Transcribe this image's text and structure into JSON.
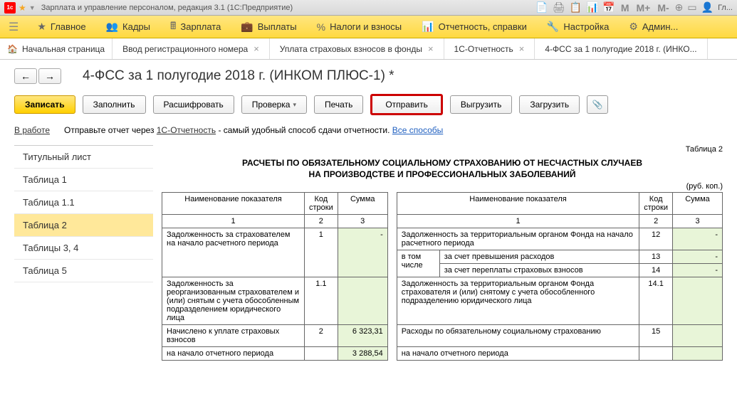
{
  "titlebar": {
    "app_icon": "1с",
    "text": "Зарплата и управление персоналом, редакция 3.1  (1С:Предприятие)",
    "user_label": "Гл..."
  },
  "mainmenu": {
    "items": [
      {
        "label": "Главное"
      },
      {
        "label": "Кадры"
      },
      {
        "label": "Зарплата"
      },
      {
        "label": "Выплаты"
      },
      {
        "label": "Налоги и взносы"
      },
      {
        "label": "Отчетность, справки"
      },
      {
        "label": "Настройка"
      },
      {
        "label": "Админ..."
      }
    ]
  },
  "tabs": [
    {
      "label": "Начальная страница",
      "closable": false
    },
    {
      "label": "Ввод регистрационного номера",
      "closable": true
    },
    {
      "label": "Уплата страховых взносов в фонды",
      "closable": true
    },
    {
      "label": "1С-Отчетность",
      "closable": true
    },
    {
      "label": "4-ФСС за 1 полугодие 2018 г. (ИНКО...",
      "closable": true
    }
  ],
  "page": {
    "title": "4-ФСС за 1 полугодие 2018 г. (ИНКОМ ПЛЮС-1) *"
  },
  "actions": {
    "save": "Записать",
    "fill": "Заполнить",
    "decode": "Расшифровать",
    "check": "Проверка",
    "print": "Печать",
    "send": "Отправить",
    "export": "Выгрузить",
    "import": "Загрузить"
  },
  "info": {
    "status_link": "В работе",
    "hint_prefix": "Отправьте отчет через ",
    "hint_link": "1С-Отчетность",
    "hint_suffix": " - самый удобный способ сдачи отчетности. ",
    "all_methods": "Все способы"
  },
  "sidebar": {
    "items": [
      {
        "label": "Титульный лист"
      },
      {
        "label": "Таблица 1"
      },
      {
        "label": "Таблица 1.1"
      },
      {
        "label": "Таблица 2"
      },
      {
        "label": "Таблицы 3, 4"
      },
      {
        "label": "Таблица 5"
      }
    ],
    "active_index": 3
  },
  "table": {
    "caption": "Таблица 2",
    "title": "РАСЧЕТЫ ПО ОБЯЗАТЕЛЬНОМУ СОЦИАЛЬНОМУ СТРАХОВАНИЮ ОТ НЕСЧАСТНЫХ СЛУЧАЕВ",
    "subtitle": "НА ПРОИЗВОДСТВЕ И ПРОФЕССИОНАЛЬНЫХ ЗАБОЛЕВАНИЙ",
    "unit": "(руб. коп.)",
    "headers": {
      "name": "Наименование показателя",
      "code": "Код строки",
      "sum": "Сумма"
    },
    "colnums_left": [
      "1",
      "2",
      "3"
    ],
    "colnums_right": [
      "1",
      "2",
      "3"
    ],
    "rows_left": [
      {
        "name": "Задолженность за страхователем на начало расчетного периода",
        "code": "1",
        "sum": "-"
      },
      {
        "name": "Задолженность за реорганизованным страхователем и (или) снятым с учета обособленным подразделением юридического лица",
        "code": "1.1",
        "sum": ""
      },
      {
        "name": "Начислено к уплате страховых взносов",
        "code": "2",
        "sum": "6 323,31"
      },
      {
        "name": "на начало отчетного периода",
        "code": "",
        "sum": "3 288,54"
      }
    ],
    "rows_right": [
      {
        "name": "Задолженность за территориальным органом Фонда на начало расчетного периода",
        "code": "12",
        "sum": "-"
      },
      {
        "name": "в том числе",
        "sub": "за счет превышения расходов",
        "code": "13",
        "sum": "-"
      },
      {
        "name": "",
        "sub": "за счет переплаты страховых взносов",
        "code": "14",
        "sum": "-"
      },
      {
        "name": "Задолженность за территориальным органом Фонда страхователя и (или) снятому с учета обособленного подразделению юридического лица",
        "code": "14.1",
        "sum": ""
      },
      {
        "name": "Расходы по обязательному социальному страхованию",
        "code": "15",
        "sum": ""
      },
      {
        "name": "на начало отчетного периода",
        "code": "",
        "sum": ""
      }
    ]
  }
}
